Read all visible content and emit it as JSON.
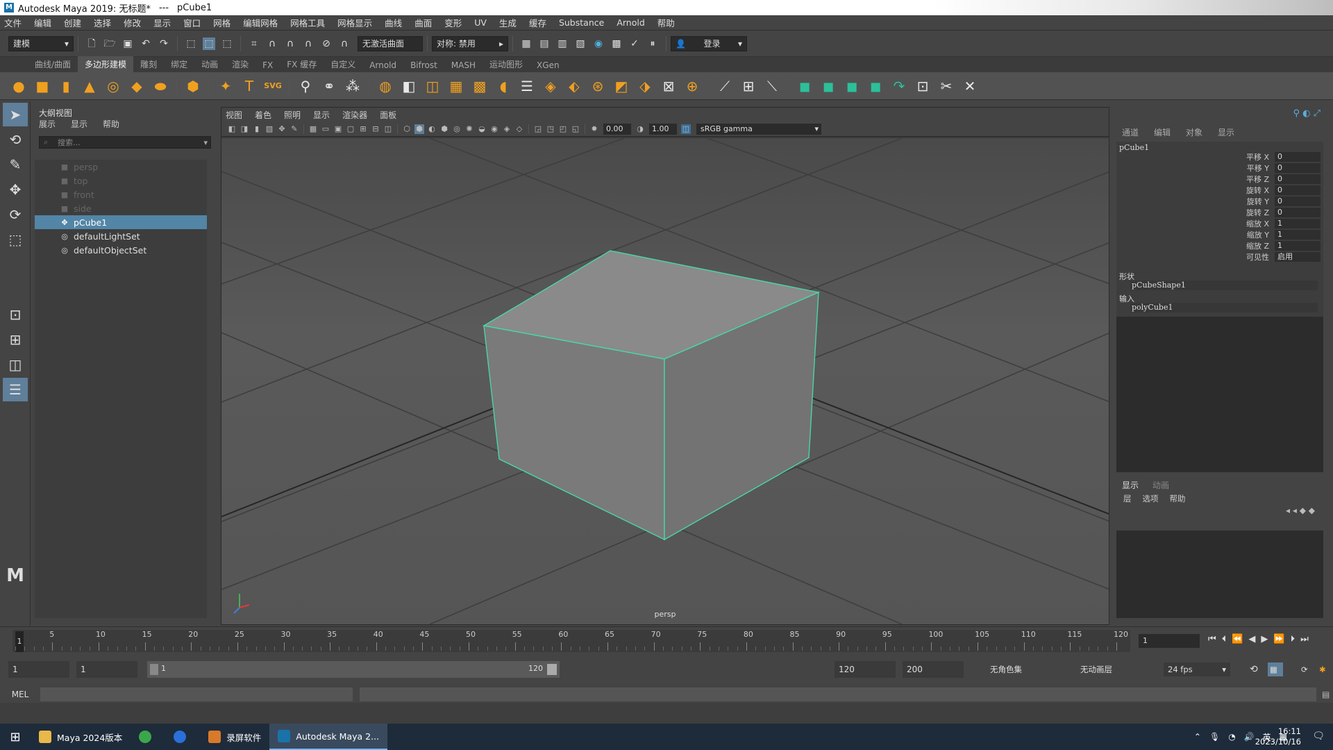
{
  "window": {
    "title": "Autodesk Maya 2019: 无标题*",
    "separator": "---",
    "object": "pCube1"
  },
  "menubar": [
    "文件",
    "编辑",
    "创建",
    "选择",
    "修改",
    "显示",
    "窗口",
    "网格",
    "编辑网格",
    "网格工具",
    "网格显示",
    "曲线",
    "曲面",
    "变形",
    "UV",
    "生成",
    "缓存",
    "Substance",
    "Arnold",
    "帮助"
  ],
  "statusline": {
    "mode": "建模",
    "live_surface": "无激活曲面",
    "symmetry": "对称: 禁用",
    "login": "登录"
  },
  "shelf_tabs": [
    "曲线/曲面",
    "多边形建模",
    "雕刻",
    "绑定",
    "动画",
    "渲染",
    "FX",
    "FX 缓存",
    "自定义",
    "Arnold",
    "Bifrost",
    "MASH",
    "运动图形",
    "XGen"
  ],
  "shelf_tabs_active": "多边形建模",
  "outliner": {
    "title": "大纲视图",
    "menu": [
      "展示",
      "显示",
      "帮助"
    ],
    "search_placeholder": "搜索...",
    "items": [
      {
        "label": "persp",
        "dim": true
      },
      {
        "label": "top",
        "dim": true
      },
      {
        "label": "front",
        "dim": true
      },
      {
        "label": "side",
        "dim": true
      },
      {
        "label": "pCube1",
        "selected": true
      },
      {
        "label": "defaultLightSet"
      },
      {
        "label": "defaultObjectSet"
      }
    ]
  },
  "viewport": {
    "menu": [
      "视图",
      "着色",
      "照明",
      "显示",
      "渲染器",
      "面板"
    ],
    "exposure": "0.00",
    "gamma": "1.00",
    "color_space": "sRGB gamma",
    "camera_label": "persp"
  },
  "channelbox": {
    "menu": [
      "通道",
      "编辑",
      "对象",
      "显示"
    ],
    "object_name": "pCube1",
    "attributes": [
      {
        "name": "平移 X",
        "value": "0"
      },
      {
        "name": "平移 Y",
        "value": "0"
      },
      {
        "name": "平移 Z",
        "value": "0"
      },
      {
        "name": "旋转 X",
        "value": "0"
      },
      {
        "name": "旋转 Y",
        "value": "0"
      },
      {
        "name": "旋转 Z",
        "value": "0"
      },
      {
        "name": "缩放 X",
        "value": "1"
      },
      {
        "name": "缩放 Y",
        "value": "1"
      },
      {
        "name": "缩放 Z",
        "value": "1"
      },
      {
        "name": "可见性",
        "value": "启用"
      }
    ],
    "shapes_label": "形状",
    "shape_node": "pCubeShape1",
    "inputs_label": "输入",
    "input_node": "polyCube1"
  },
  "layers": {
    "tabs": [
      "显示",
      "动画"
    ],
    "menu": [
      "层",
      "选项",
      "帮助"
    ]
  },
  "timeslider": {
    "ticks": [
      "5",
      "10",
      "15",
      "20",
      "25",
      "30",
      "35",
      "40",
      "45",
      "50",
      "55",
      "60",
      "65",
      "70",
      "75",
      "80",
      "85",
      "90",
      "95",
      "100",
      "105",
      "110",
      "115",
      "120"
    ],
    "current": "1",
    "current_field": "1"
  },
  "rangeslider": {
    "start": "1",
    "playback_start": "1",
    "bar_start": "1",
    "bar_end": "120",
    "playback_end": "120",
    "end": "200",
    "character_set": "无角色集",
    "anim_layer": "无动画层",
    "fps": "24 fps"
  },
  "cmdline": {
    "label": "MEL"
  },
  "taskbar": {
    "items": [
      {
        "label": "Maya 2024版本",
        "color": "#e8b84a"
      },
      {
        "label": "",
        "color": "#3aa84a"
      },
      {
        "label": "",
        "color": "#2a70d8"
      },
      {
        "label": "录屏软件",
        "color": "#d87a2a"
      },
      {
        "label": "Autodesk Maya 2...",
        "color": "#1a73a8",
        "active": true
      }
    ],
    "ime": "英",
    "time": "16:11",
    "date": "2023/10/16"
  }
}
